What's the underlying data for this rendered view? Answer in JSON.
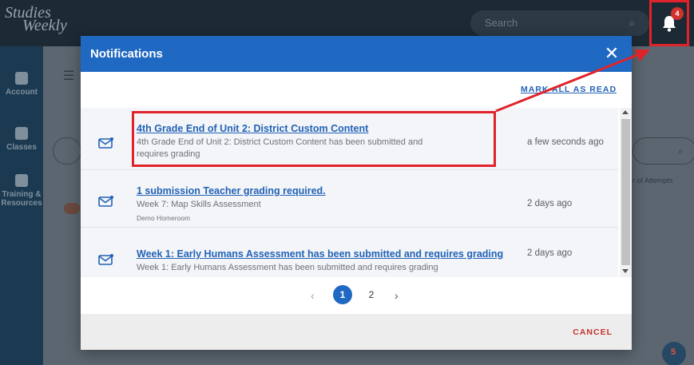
{
  "app": {
    "logo_line1": "Studies",
    "logo_line2": "Weekly",
    "search_placeholder": "Search",
    "notification_count": "4"
  },
  "nav": {
    "items": [
      {
        "label": "Account"
      },
      {
        "label": "Classes"
      },
      {
        "label": "Training & Resources"
      }
    ]
  },
  "background": {
    "column_label": "r of Attempts",
    "help_badge": "5"
  },
  "modal": {
    "title": "Notifications",
    "mark_all_read": "MARK ALL AS READ",
    "cancel": "CANCEL",
    "notifications": [
      {
        "title": "4th Grade End of Unit 2: District Custom Content",
        "description": "4th Grade End of Unit 2: District  Custom Content has been submitted and requires grading",
        "time": "a few seconds ago"
      },
      {
        "title": "1 submission Teacher grading required.",
        "description": "Week 7: Map Skills Assessment",
        "subtext": "Demo Homeroom",
        "time": "2 days ago"
      },
      {
        "title": "Week 1: Early Humans Assessment has been submitted and requires grading",
        "description": "Week 1: Early Humans Assessment has been submitted and requires grading",
        "time": "2 days ago"
      }
    ],
    "pagination": {
      "prev": "‹",
      "pages": [
        "1",
        "2"
      ],
      "current": "1",
      "next": "›"
    }
  },
  "colors": {
    "header_blue": "#2069c2",
    "link_blue": "#2262b6",
    "annotation_red": "#e0232b",
    "cancel_red": "#c6332c"
  }
}
